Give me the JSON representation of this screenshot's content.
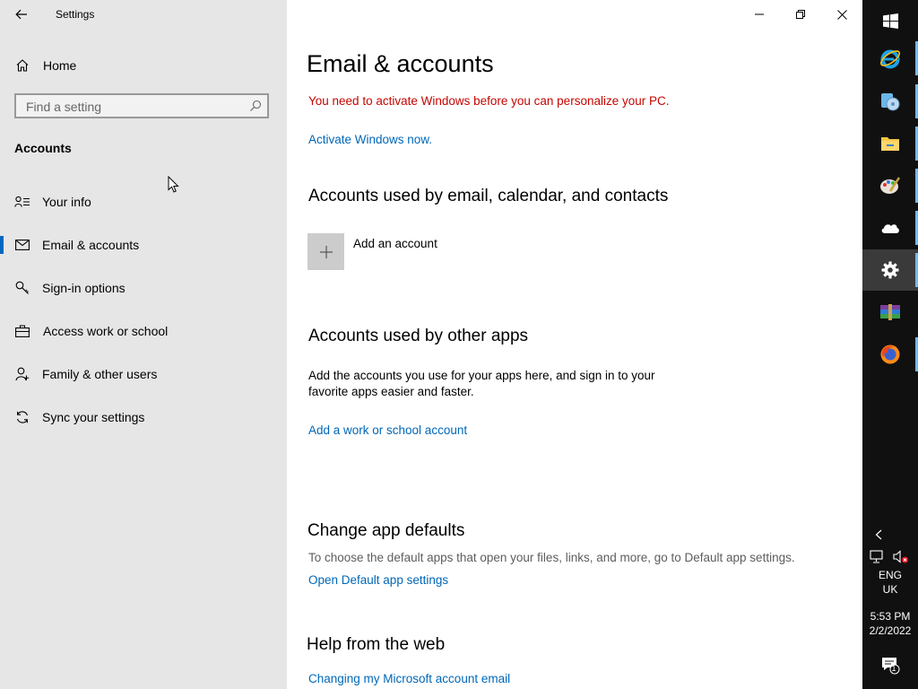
{
  "window": {
    "title": "Settings"
  },
  "sidebar": {
    "home_label": "Home",
    "search_placeholder": "Find a setting",
    "section_title": "Accounts",
    "items": [
      {
        "label": "Your info",
        "icon": "person-card-icon",
        "selected": false
      },
      {
        "label": "Email & accounts",
        "icon": "mail-icon",
        "selected": true
      },
      {
        "label": "Sign-in options",
        "icon": "key-icon",
        "selected": false
      },
      {
        "label": "Access work or school",
        "icon": "briefcase-icon",
        "selected": false
      },
      {
        "label": "Family & other users",
        "icon": "person-add-icon",
        "selected": false
      },
      {
        "label": "Sync your settings",
        "icon": "sync-icon",
        "selected": false
      }
    ]
  },
  "main": {
    "title": "Email & accounts",
    "activation_warning": "You need to activate Windows before you can personalize your PC.",
    "activate_link": "Activate Windows now.",
    "email_section": {
      "heading": "Accounts used by email, calendar, and contacts",
      "add_account_label": "Add an account"
    },
    "other_apps_section": {
      "heading": "Accounts used by other apps",
      "description_line1": "Add the accounts you use for your apps here, and sign in to your",
      "description_line2": "favorite apps easier and faster.",
      "link": "Add a work or school account"
    },
    "defaults_section": {
      "heading": "Change app defaults",
      "description": "To choose the default apps that open your files, links, and more, go to Default app settings.",
      "link": "Open Default app settings"
    },
    "help_section": {
      "heading": "Help from the web",
      "link": "Changing my Microsoft account email"
    }
  },
  "taskbar": {
    "apps": [
      "start-icon",
      "internet-explorer-icon",
      "media-player-icon",
      "file-explorer-icon",
      "paint-icon",
      "onedrive-icon",
      "settings-icon",
      "winrar-icon",
      "firefox-icon"
    ],
    "active_app": "settings-icon",
    "language_line1": "ENG",
    "language_line2": "UK",
    "time": "5:53 PM",
    "date": "2/2/2022",
    "notification_count": "1"
  },
  "colors": {
    "accent": "#0067c0",
    "link": "#0067b8",
    "warning": "#c50500",
    "sidebar_bg": "#e6e6e6",
    "taskbar_bg": "#101010"
  }
}
